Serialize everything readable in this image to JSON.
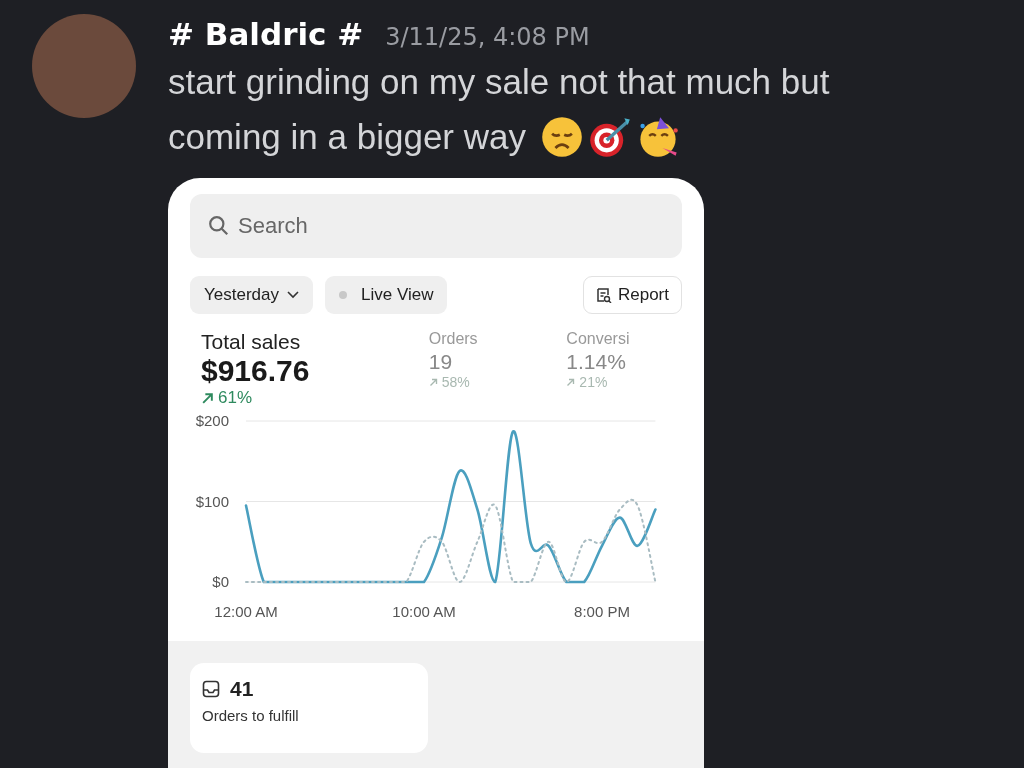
{
  "message": {
    "author": "# Baldric #",
    "timestamp": "3/11/25, 4:08 PM",
    "lines": [
      "start grinding on my sale not that much but",
      "coming in a bigger way"
    ]
  },
  "embedded_screenshot": {
    "search": {
      "placeholder": "Search"
    },
    "filters": [
      {
        "kind": "dropdown",
        "label": "Yesterday"
      },
      {
        "kind": "live",
        "label": "Live View"
      }
    ],
    "report_button": "Report",
    "stats": [
      {
        "label": "Total sales",
        "value": "$916.76",
        "change": "61%",
        "primary": true
      },
      {
        "label": "Orders",
        "value": "19",
        "change": "58%",
        "primary": false
      },
      {
        "label": "Conversi",
        "value": "1.14%",
        "change": "21%",
        "primary": false
      }
    ],
    "chart_data": {
      "type": "line",
      "x": [
        0,
        1,
        2,
        3,
        4,
        5,
        6,
        7,
        8,
        9,
        10,
        11,
        12,
        13,
        14,
        15,
        16,
        17,
        18,
        19,
        20,
        21,
        22,
        23
      ],
      "series": [
        {
          "color": "#4a9fbf",
          "line_style": "solid",
          "values": [
            95,
            0,
            0,
            0,
            0,
            0,
            0,
            0,
            0,
            0,
            0,
            55,
            138,
            90,
            0,
            187,
            48,
            45,
            0,
            0,
            45,
            80,
            45,
            90
          ]
        },
        {
          "color": "#a9bcc2",
          "line_style": "dotted",
          "values": [
            0,
            0,
            0,
            0,
            0,
            0,
            0,
            0,
            0,
            0,
            50,
            50,
            0,
            50,
            95,
            0,
            0,
            50,
            0,
            50,
            50,
            90,
            95,
            0
          ]
        }
      ],
      "xticks": [
        {
          "value": 0,
          "label": "12:00 AM"
        },
        {
          "value": 10,
          "label": "10:00 AM"
        },
        {
          "value": 20,
          "label": "8:00 PM"
        }
      ],
      "yticks": [
        {
          "value": 0,
          "label": "$0"
        },
        {
          "value": 100,
          "label": "$100"
        },
        {
          "value": 200,
          "label": "$200"
        }
      ],
      "xlim": [
        0,
        23
      ],
      "ylim": [
        0,
        200
      ]
    },
    "tasks": [
      {
        "count": "41",
        "label": "Orders to fulfill"
      }
    ]
  }
}
